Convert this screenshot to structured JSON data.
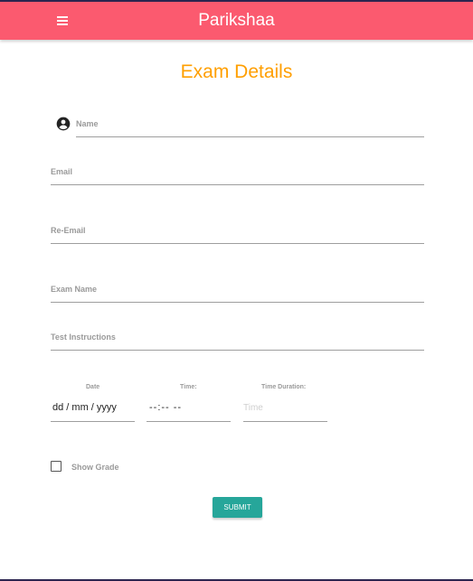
{
  "app": {
    "title": "Parikshaa",
    "menu_icon": "hamburger-menu-icon",
    "bar_color": "#fb5a6f"
  },
  "page": {
    "title": "Exam Details",
    "title_color": "#ff9f00"
  },
  "form": {
    "name_label": "Name",
    "name_icon": "account-circle-icon",
    "email_label": "Email",
    "reemail_label": "Re-Email",
    "exam_name_label": "Exam Name",
    "instructions_label": "Test Instructions",
    "date_label": "Date",
    "date_value": "dd / mm / yyyy",
    "time_label": "Time:",
    "time_value": "--:--  --",
    "duration_label": "Time Duration:",
    "duration_placeholder": "Time",
    "show_grade_label": "Show Grade",
    "show_grade_checked": false,
    "submit_label": "SUBMIT",
    "submit_color": "#26a69a"
  }
}
